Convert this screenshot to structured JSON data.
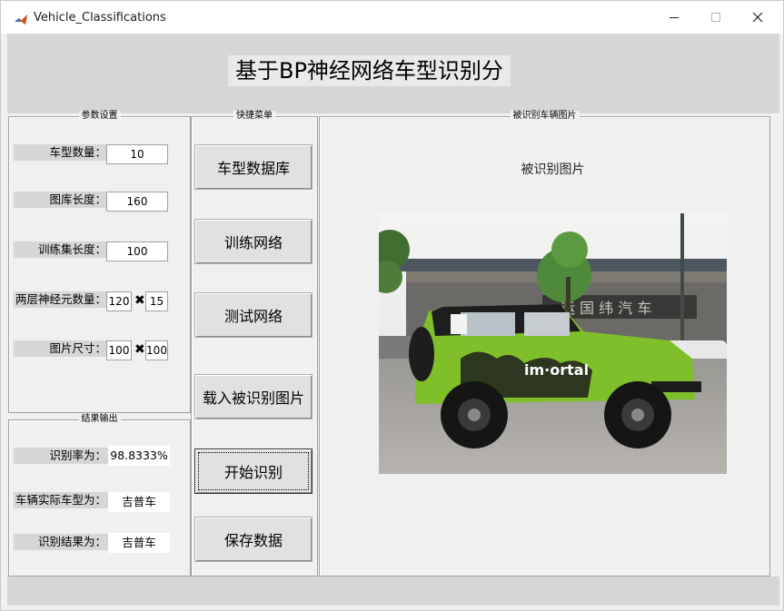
{
  "window": {
    "title": "Vehicle_Classifications",
    "controls": [
      "minimize",
      "maximize",
      "close"
    ]
  },
  "main_title": "基于BP神经网络车型识别分",
  "params_panel": {
    "title": "参数设置",
    "num_types_label": "车型数量：",
    "num_types_value": "10",
    "library_length_label": "图库长度：",
    "library_length_value": "160",
    "train_length_label": "训练集长度：",
    "train_length_value": "100",
    "neurons_label": "两层神经元数量：",
    "neurons_layer1": "120",
    "neurons_layer2": "15",
    "image_size_label": "图片尺寸：",
    "image_width": "100",
    "image_height": "100",
    "times_symbol": "✖"
  },
  "results_panel": {
    "title": "结果输出",
    "accuracy_label": "识别率为：",
    "accuracy_value": "98.8333%",
    "actual_type_label": "车辆实际车型为：",
    "actual_type_value": "吉普车",
    "result_label": "识别结果为：",
    "result_value": "吉普车"
  },
  "menu_panel": {
    "title": "快捷菜单",
    "buttons": [
      "车型数据库",
      "训练网络",
      "测试网络",
      "载入被识别图片",
      "开始识别",
      "保存数据"
    ]
  },
  "image_panel": {
    "title": "被识别车辆图片",
    "axes_title": "被识别图片",
    "photo_sign_text": "运 国 纬 汽 车",
    "car_logo_text": "im·ortal"
  },
  "colors": {
    "figure_bg": "#f0f0f0",
    "label_bg": "#d6d6d6",
    "button_bg": "#e1e1e1",
    "car_green": "#7fbf2a"
  }
}
